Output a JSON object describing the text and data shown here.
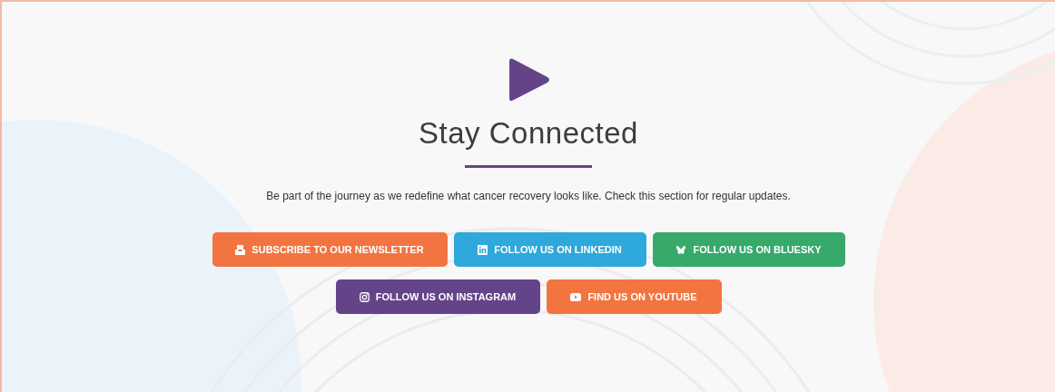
{
  "heading": "Stay Connected",
  "description": "Be part of the journey as we redefine what cancer recovery looks like. Check this section for regular updates.",
  "button_rows": [
    [
      {
        "label": "SUBSCRIBE TO OUR NEWSLETTER",
        "kind": "newsletter",
        "color": "#f27541"
      },
      {
        "label": "FOLLOW US ON LINKEDIN",
        "kind": "linkedin",
        "color": "#2fa8db"
      },
      {
        "label": "FOLLOW US ON BLUESKY",
        "kind": "bluesky",
        "color": "#37a96b"
      }
    ],
    [
      {
        "label": "FOLLOW US ON INSTAGRAM",
        "kind": "instagram",
        "color": "#634489"
      },
      {
        "label": "FIND US ON YOUTUBE",
        "kind": "youtube",
        "color": "#f27541"
      }
    ]
  ]
}
